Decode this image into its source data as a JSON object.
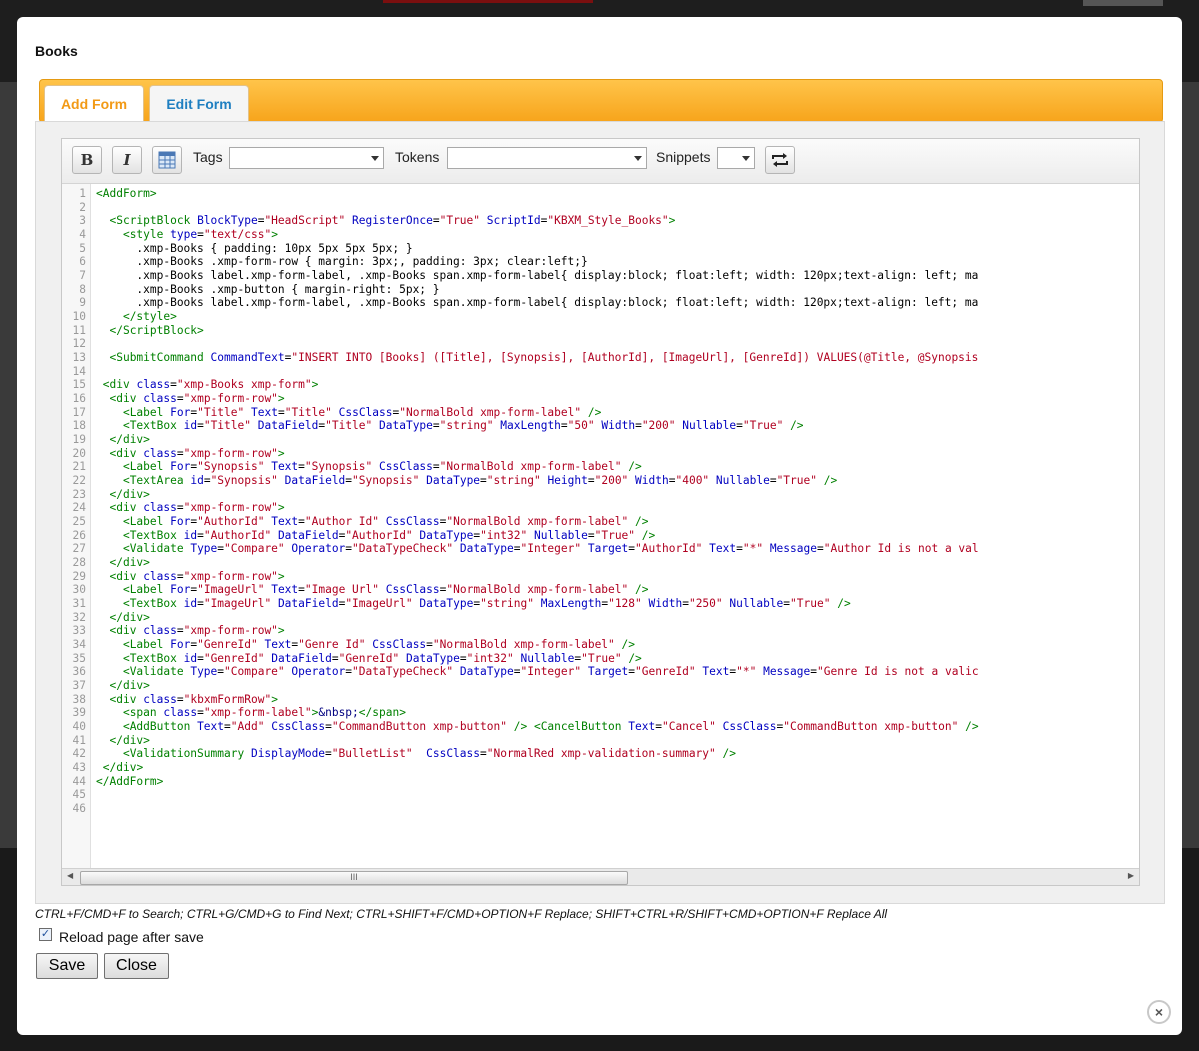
{
  "dialog": {
    "title": "Books",
    "tabs": [
      "Add Form",
      "Edit Form"
    ],
    "toolbar": {
      "bold": "B",
      "italic": "I",
      "tags_label": "Tags",
      "tokens_label": "Tokens",
      "snippets_label": "Snippets",
      "tags_value": "",
      "tokens_value": "",
      "snippets_value": ""
    },
    "shortcuts": "CTRL+F/CMD+F to Search; CTRL+G/CMD+G to Find Next; CTRL+SHIFT+F/CMD+OPTION+F Replace; SHIFT+CTRL+R/SHIFT+CMD+OPTION+F Replace All",
    "reload_label": "Reload page after save",
    "reload_checked": true,
    "save_label": "Save",
    "close_label": "Close",
    "close_glyph": "×",
    "scroll_grip": "III"
  },
  "code_lines": [
    "<AddForm>",
    "",
    "  <ScriptBlock BlockType=\"HeadScript\" RegisterOnce=\"True\" ScriptId=\"KBXM_Style_Books\">",
    "    <style type=\"text/css\">",
    "      .xmp-Books { padding: 10px 5px 5px 5px; }",
    "      .xmp-Books .xmp-form-row { margin: 3px;, padding: 3px; clear:left;}",
    "      .xmp-Books label.xmp-form-label, .xmp-Books span.xmp-form-label{ display:block; float:left; width: 120px;text-align: left; ma",
    "      .xmp-Books .xmp-button { margin-right: 5px; }",
    "      .xmp-Books label.xmp-form-label, .xmp-Books span.xmp-form-label{ display:block; float:left; width: 120px;text-align: left; ma",
    "    </style>",
    "  </ScriptBlock>",
    "",
    "  <SubmitCommand CommandText=\"INSERT INTO [Books] ([Title], [Synopsis], [AuthorId], [ImageUrl], [GenreId]) VALUES(@Title, @Synopsis",
    "",
    " <div class=\"xmp-Books xmp-form\">",
    "  <div class=\"xmp-form-row\">",
    "    <Label For=\"Title\" Text=\"Title\" CssClass=\"NormalBold xmp-form-label\" />",
    "    <TextBox id=\"Title\" DataField=\"Title\" DataType=\"string\" MaxLength=\"50\" Width=\"200\" Nullable=\"True\" />",
    "  </div>",
    "  <div class=\"xmp-form-row\">",
    "    <Label For=\"Synopsis\" Text=\"Synopsis\" CssClass=\"NormalBold xmp-form-label\" />",
    "    <TextArea id=\"Synopsis\" DataField=\"Synopsis\" DataType=\"string\" Height=\"200\" Width=\"400\" Nullable=\"True\" />",
    "  </div>",
    "  <div class=\"xmp-form-row\">",
    "    <Label For=\"AuthorId\" Text=\"Author Id\" CssClass=\"NormalBold xmp-form-label\" />",
    "    <TextBox id=\"AuthorId\" DataField=\"AuthorId\" DataType=\"int32\" Nullable=\"True\" />",
    "    <Validate Type=\"Compare\" Operator=\"DataTypeCheck\" DataType=\"Integer\" Target=\"AuthorId\" Text=\"*\" Message=\"Author Id is not a val",
    "  </div>",
    "  <div class=\"xmp-form-row\">",
    "    <Label For=\"ImageUrl\" Text=\"Image Url\" CssClass=\"NormalBold xmp-form-label\" />",
    "    <TextBox id=\"ImageUrl\" DataField=\"ImageUrl\" DataType=\"string\" MaxLength=\"128\" Width=\"250\" Nullable=\"True\" />",
    "  </div>",
    "  <div class=\"xmp-form-row\">",
    "    <Label For=\"GenreId\" Text=\"Genre Id\" CssClass=\"NormalBold xmp-form-label\" />",
    "    <TextBox id=\"GenreId\" DataField=\"GenreId\" DataType=\"int32\" Nullable=\"True\" />",
    "    <Validate Type=\"Compare\" Operator=\"DataTypeCheck\" DataType=\"Integer\" Target=\"GenreId\" Text=\"*\" Message=\"Genre Id is not a valic",
    "  </div>",
    "  <div class=\"kbxmFormRow\">",
    "    <span class=\"xmp-form-label\">&nbsp;</span>",
    "    <AddButton Text=\"Add\" CssClass=\"CommandButton xmp-button\" /> <CancelButton Text=\"Cancel\" CssClass=\"CommandButton xmp-button\" />",
    "  </div>",
    "    <ValidationSummary DisplayMode=\"BulletList\"  CssClass=\"NormalRed xmp-validation-summary\" />",
    " </div>",
    "</AddForm>",
    "",
    ""
  ]
}
